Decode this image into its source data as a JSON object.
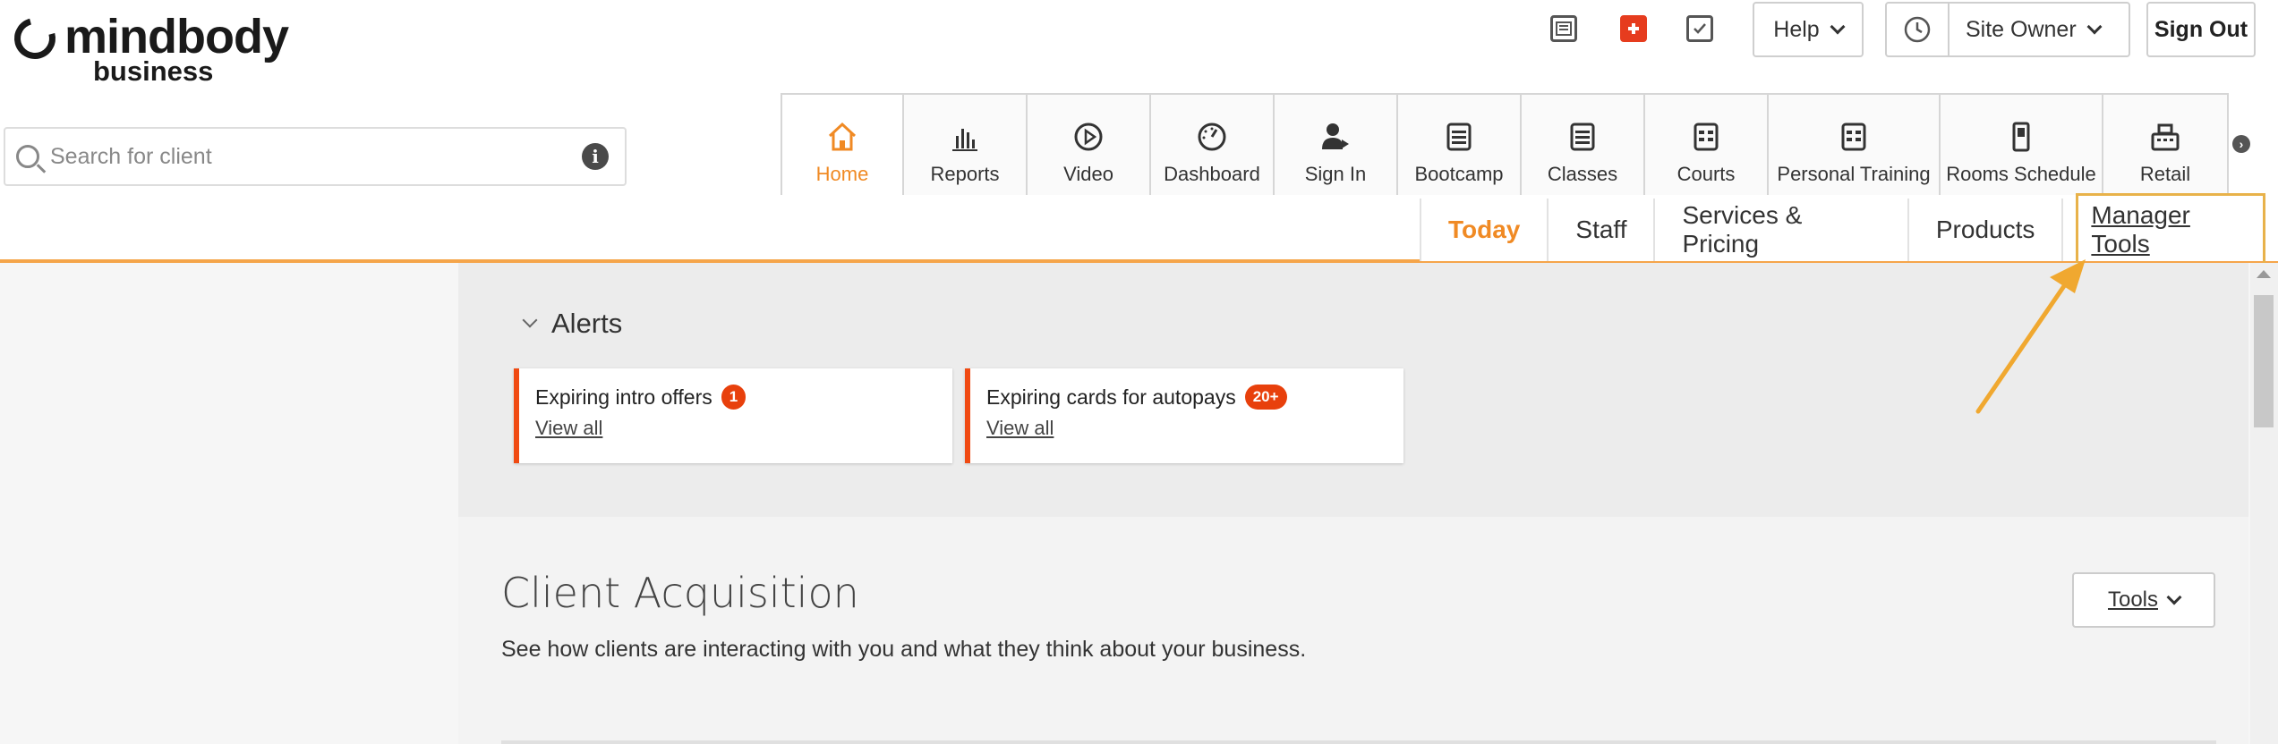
{
  "brand": {
    "name": "mindbody",
    "sub": "business"
  },
  "topbar": {
    "icons": [
      "newspaper-icon",
      "first-aid-icon",
      "checkbox-icon"
    ],
    "help_label": "Help",
    "clock_icon": "clock-icon",
    "user_label": "Site Owner",
    "signout_label": "Sign Out"
  },
  "search": {
    "placeholder": "Search for client",
    "value": ""
  },
  "nav": {
    "tabs": [
      {
        "label": "Home",
        "icon": "home-icon",
        "active": true
      },
      {
        "label": "Reports",
        "icon": "bar-chart-icon"
      },
      {
        "label": "Video",
        "icon": "play-icon"
      },
      {
        "label": "Dashboard",
        "icon": "gauge-icon"
      },
      {
        "label": "Sign In",
        "icon": "user-signin-icon"
      },
      {
        "label": "Bootcamp",
        "icon": "calendar-icon"
      },
      {
        "label": "Classes",
        "icon": "calendar-icon"
      },
      {
        "label": "Courts",
        "icon": "calendar-icon"
      },
      {
        "label": "Personal Training",
        "icon": "calendar-icon"
      },
      {
        "label": "Rooms Schedule",
        "icon": "door-icon"
      },
      {
        "label": "Retail",
        "icon": "register-icon"
      }
    ]
  },
  "subnav": {
    "tabs": [
      "Today",
      "Staff",
      "Services & Pricing",
      "Products",
      "Manager Tools"
    ]
  },
  "alerts": {
    "title": "Alerts",
    "items": [
      {
        "title": "Expiring intro offers",
        "badge": "1",
        "link": "View all"
      },
      {
        "title": "Expiring cards for autopays",
        "badge": "20+",
        "link": "View all"
      }
    ]
  },
  "client_acquisition": {
    "title": "Client Acquisition",
    "description": "See how clients are interacting with you and what they think about your business.",
    "tools_label": "Tools"
  },
  "colors": {
    "accent": "#f08a24",
    "alert": "#e8400c",
    "highlight": "#e8b24a"
  }
}
